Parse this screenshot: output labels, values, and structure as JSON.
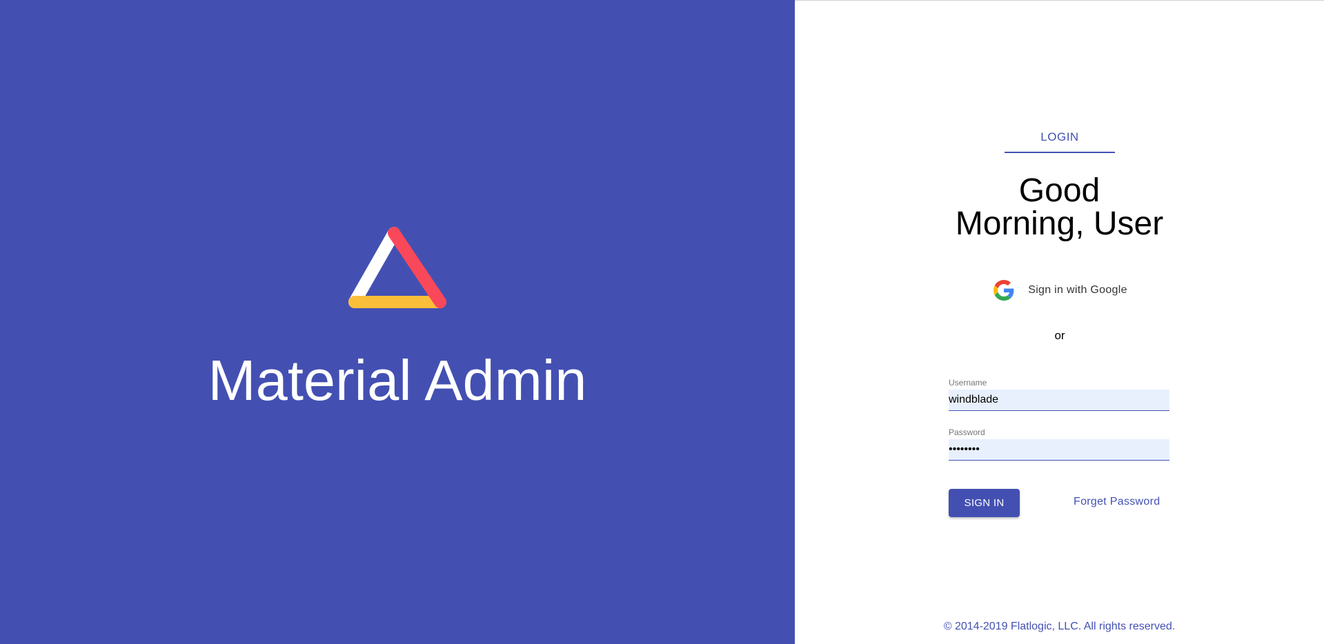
{
  "brand": {
    "title": "Material Admin",
    "logo_icon": "triangle-logo-icon",
    "background_color": "#4350b2",
    "logo_colors": {
      "left_edge": "#ffffff",
      "right_edge": "#f9485a",
      "bottom_edge": "#fbbe3a"
    }
  },
  "auth": {
    "tab_label": "LOGIN",
    "greeting": "Good Morning, User",
    "google_button_label": "Sign in with Google",
    "google_icon": "google-icon",
    "divider_text": "or",
    "username": {
      "label": "Username",
      "value": "windblade"
    },
    "password": {
      "label": "Password",
      "value": "••••••••"
    },
    "submit_label": "SIGN IN",
    "forget_password_label": "Forget Password"
  },
  "footer": {
    "copyright": "© 2014-2019 Flatlogic, LLC. All rights reserved."
  },
  "accent_color": "#4350b2"
}
